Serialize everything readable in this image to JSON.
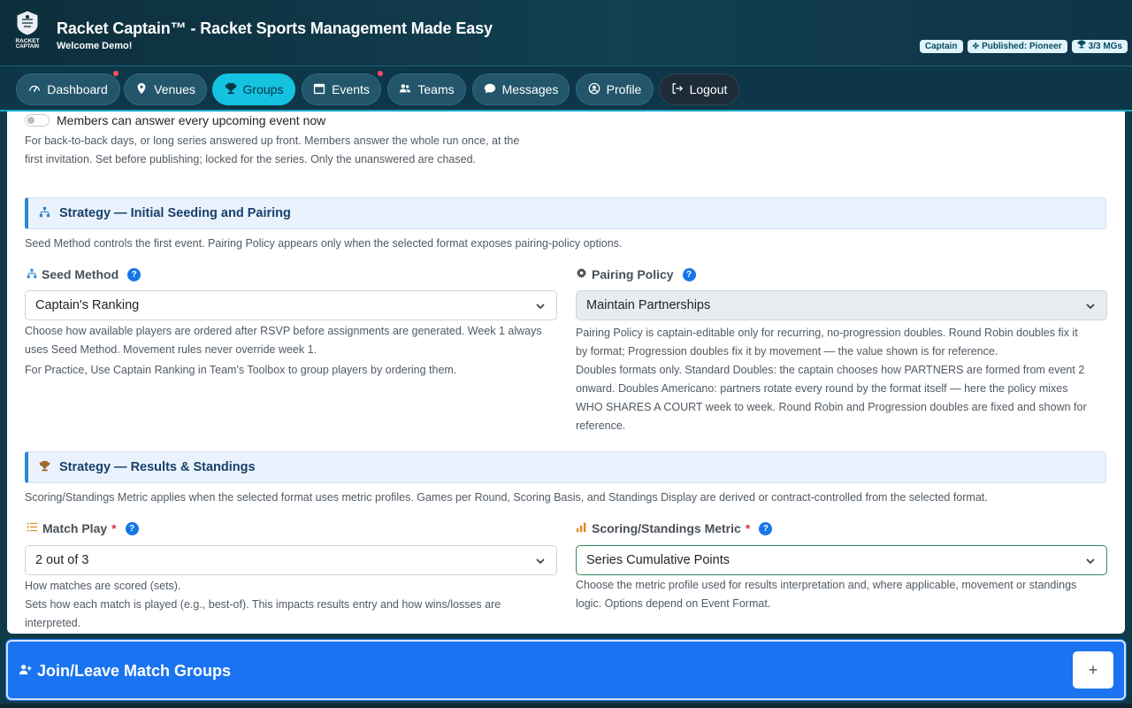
{
  "header": {
    "app_title": "Racket Captain™ - Racket Sports Management Made Easy",
    "welcome": "Welcome Demo!",
    "logo_text_line1": "RACKET",
    "logo_text_line2": "CAPTAIN",
    "badges": {
      "role": "Captain",
      "published": "Published: Pioneer",
      "mgs": "3/3 MGs"
    }
  },
  "nav": {
    "items": [
      {
        "label": "Dashboard",
        "icon": "gauge-icon",
        "notification": true
      },
      {
        "label": "Venues",
        "icon": "map-pin-icon",
        "notification": false
      },
      {
        "label": "Groups",
        "icon": "trophy-icon",
        "notification": false,
        "active": true
      },
      {
        "label": "Events",
        "icon": "calendar-icon",
        "notification": true
      },
      {
        "label": "Teams",
        "icon": "people-icon",
        "notification": false
      },
      {
        "label": "Messages",
        "icon": "chat-icon",
        "notification": false
      },
      {
        "label": "Profile",
        "icon": "user-circle-icon",
        "notification": false
      },
      {
        "label": "Logout",
        "icon": "logout-icon",
        "notification": false
      }
    ]
  },
  "series_answer": {
    "toggle_label": "Members can answer every upcoming event now",
    "toggle_on": false,
    "help_line1": "For back-to-back days, or long series answered up front. Members answer the whole run once, at the",
    "help_line2": "first invitation. Set before publishing; locked for the series. Only the unanswered are chased."
  },
  "seeding_section": {
    "title": "Strategy — Initial Seeding and Pairing",
    "description": "Seed Method controls the first event. Pairing Policy appears only when the selected format exposes pairing-policy options.",
    "seed_method": {
      "label": "Seed Method",
      "value": "Captain's Ranking",
      "help_line1": "Choose how available players are ordered after RSVP before assignments are generated. Week 1 always",
      "help_line2": "uses Seed Method. Movement rules never override week 1.",
      "help_line3": "For Practice, Use Captain Ranking in Team's Toolbox to group players by ordering them."
    },
    "pairing_policy": {
      "label": "Pairing Policy",
      "value": "Maintain Partnerships",
      "help_line1": "Pairing Policy is captain-editable only for recurring, no-progression doubles. Round Robin doubles fix it",
      "help_line2": "by format; Progression doubles fix it by movement — the value shown is for reference.",
      "help_line3": "Doubles formats only. Standard Doubles: the captain chooses how PARTNERS are formed from event 2",
      "help_line4": "onward. Doubles Americano: partners rotate every round by the format itself — here the policy mixes",
      "help_line5": "WHO SHARES A COURT week to week. Round Robin and Progression doubles are fixed and shown for",
      "help_line6": "reference."
    }
  },
  "results_section": {
    "title": "Strategy — Results & Standings",
    "description": "Scoring/Standings Metric applies when the selected format uses metric profiles. Games per Round, Scoring Basis, and Standings Display are derived or contract-controlled from the selected format.",
    "match_play": {
      "label": "Match Play",
      "required": "*",
      "value": "2 out of 3",
      "help_line1": "How matches are scored (sets).",
      "help_line2": "Sets how each match is played (e.g., best-of). This impacts results entry and how wins/losses are",
      "help_line3": "interpreted."
    },
    "scoring_metric": {
      "label": "Scoring/Standings Metric",
      "required": "*",
      "value": "Series Cumulative Points",
      "help_line1": "Choose the metric profile used for results interpretation and, where applicable, movement or standings",
      "help_line2": "logic. Options depend on Event Format."
    }
  },
  "bottom_bar": {
    "title": "Join/Leave Match Groups",
    "expand_symbol": "+"
  },
  "help_symbol": "?",
  "colors": {
    "accent": "#14c3df",
    "primary_blue": "#1a73f0",
    "header_bg": "#0d2f3c",
    "notification": "#ff4d5e"
  }
}
